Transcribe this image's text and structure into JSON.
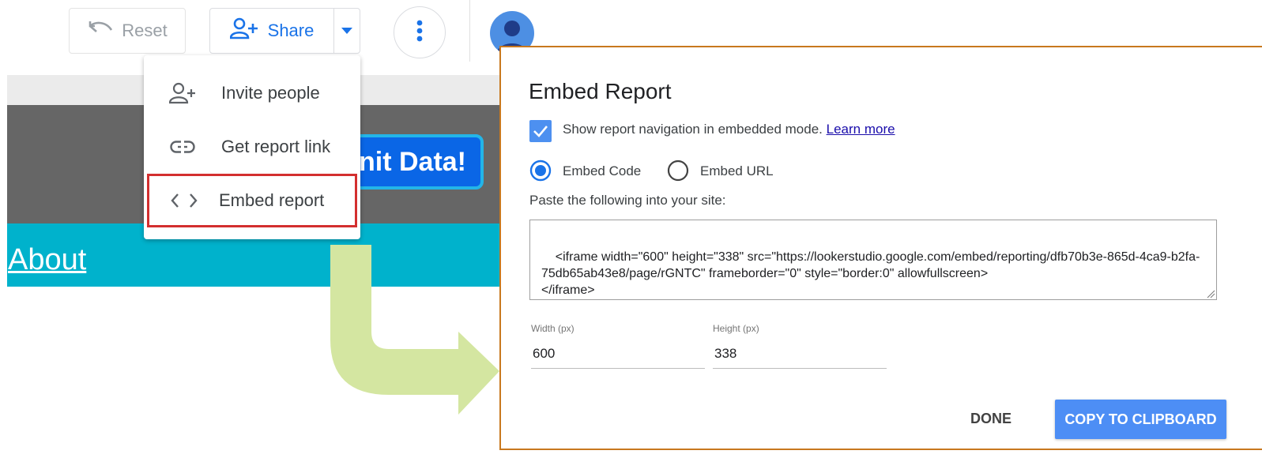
{
  "toolbar": {
    "reset_label": "Reset",
    "share_label": "Share",
    "reset_icon": "undo-icon",
    "share_icon": "person-add-icon",
    "dropdown_icon": "caret-down-icon",
    "more_icon": "more-vert-icon",
    "avatar_icon": "account-avatar-icon"
  },
  "report": {
    "submit_text": "nit Data!",
    "about_text": "About"
  },
  "share_menu": {
    "items": [
      {
        "label": "Invite people",
        "icon": "person-add-icon"
      },
      {
        "label": "Get report link",
        "icon": "link-icon"
      },
      {
        "label": "Embed report",
        "icon": "code-icon"
      }
    ]
  },
  "dialog": {
    "title": "Embed Report",
    "show_nav_label": "Show report navigation in embedded mode.",
    "learn_more": "Learn more",
    "show_nav_checked": true,
    "embed_code_label": "Embed Code",
    "embed_url_label": "Embed URL",
    "selected_option": "Embed Code",
    "paste_label": "Paste the following into your site:",
    "embed_code": "<iframe width=\"600\" height=\"338\" src=\"https://lookerstudio.google.com/embed/reporting/dfb70b3e-865d-4ca9-b2fa-75db65ab43e8/page/rGNTC\" frameborder=\"0\" style=\"border:0\" allowfullscreen>\n</iframe>",
    "width_label": "Width (px)",
    "width_value": "600",
    "height_label": "Height (px)",
    "height_value": "338",
    "done_label": "DONE",
    "copy_label": "COPY TO CLIPBOARD"
  },
  "colors": {
    "accent_blue": "#1a73e8",
    "highlight_red": "#d32f2f",
    "arrow_green": "#d4e6a1",
    "dialog_border": "#c8781e",
    "cyan_band": "#00b2cc"
  }
}
